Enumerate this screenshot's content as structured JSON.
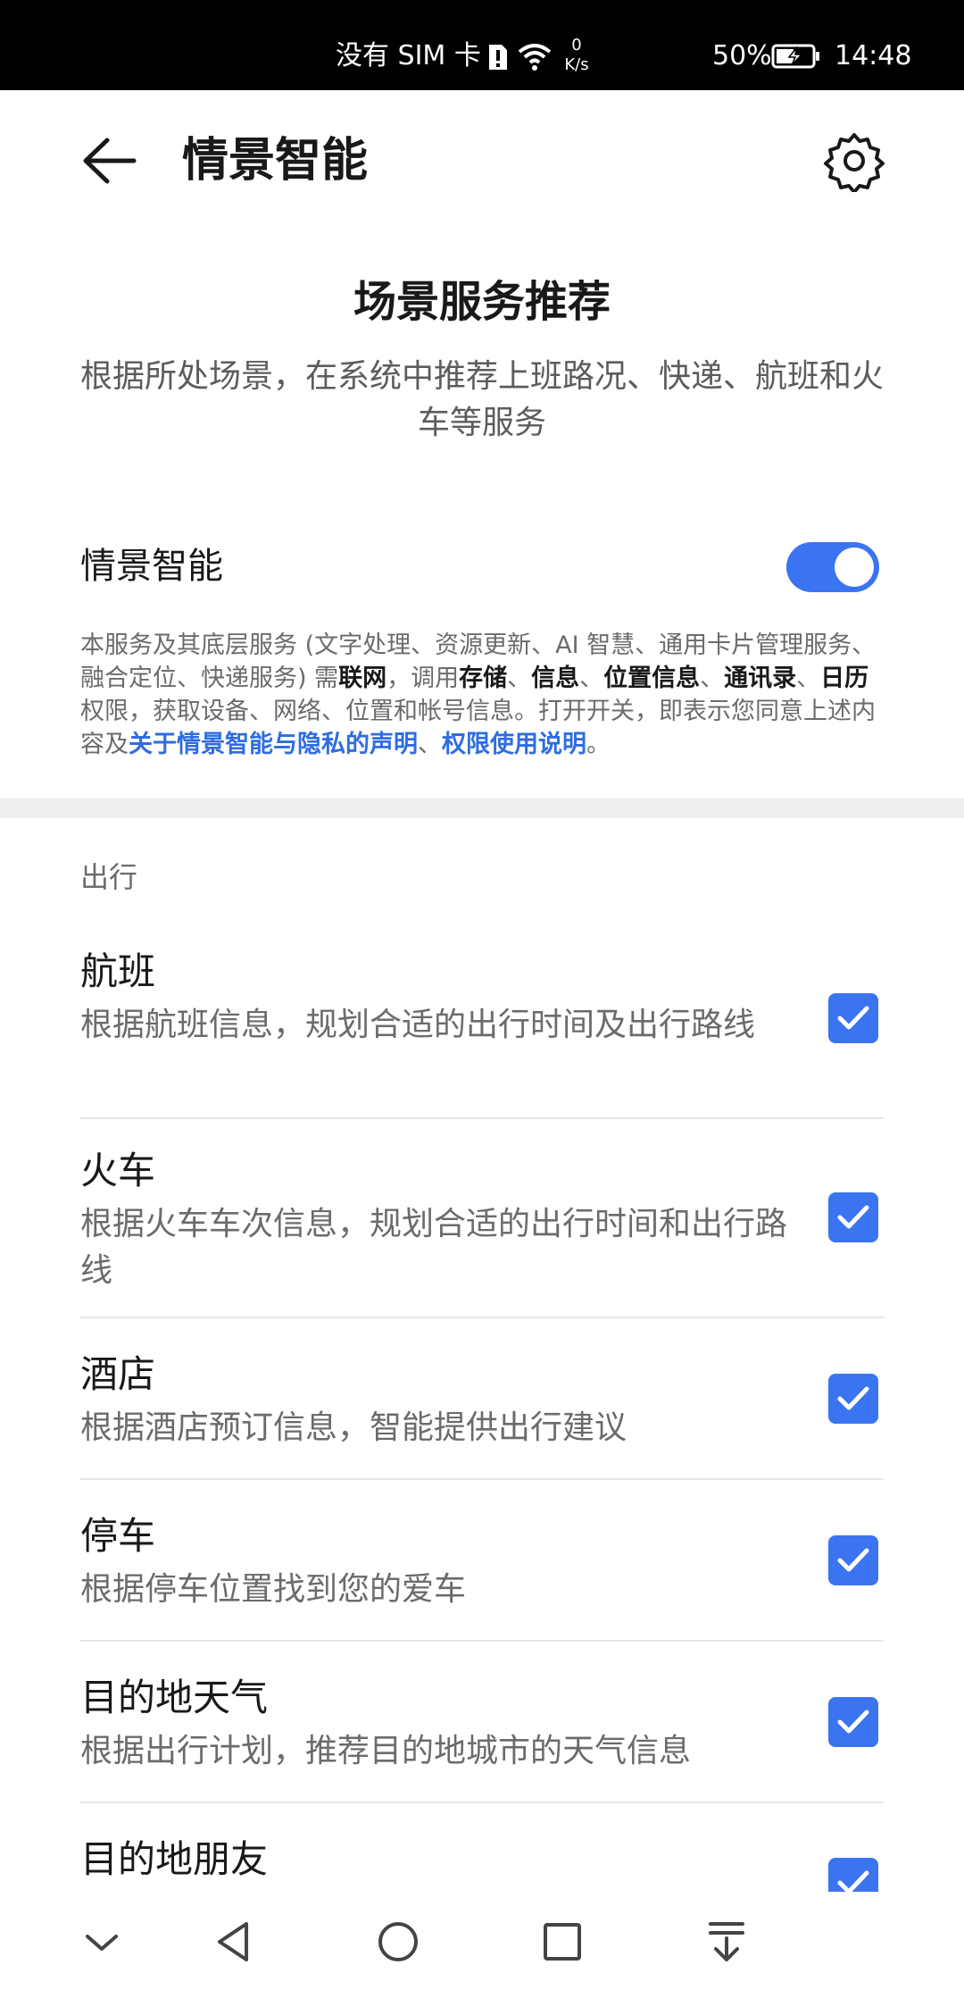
{
  "status_bar": {
    "carrier": "没有 SIM 卡",
    "net_speed_value": "0",
    "net_speed_unit": "K/s",
    "battery_percent": "50%",
    "time": "14:48"
  },
  "header": {
    "title": "情景智能"
  },
  "hero": {
    "title": "场景服务推荐",
    "subtitle": "根据所处场景，在系统中推荐上班路况、快递、航班和火车等服务"
  },
  "toggle": {
    "label": "情景智能",
    "on": true
  },
  "notice": {
    "p1": "本服务及其底层服务 (文字处理、资源更新、AI 智慧、通用卡片管理服务、融合定位、快递服务) 需",
    "b1": "联网",
    "p2": "，调用",
    "b2": "存储",
    "p3": "、",
    "b3": "信息",
    "p4": "、",
    "b4": "位置信息",
    "p5": "、",
    "b5": "通讯录",
    "p6": "、",
    "b6": "日历",
    "p7": "权限，获取设备、网络、位置和帐号信息。打开开关，即表示您同意上述内容及",
    "link1": "关于情景智能与隐私的声明",
    "p8": "、",
    "link2": "权限使用说明",
    "p9": "。"
  },
  "section": {
    "label": "出行"
  },
  "items": [
    {
      "title": "航班",
      "desc": "根据航班信息，规划合适的出行时间及出行路线",
      "checked": true
    },
    {
      "title": "火车",
      "desc": "根据火车车次信息，规划合适的出行时间和出行路线",
      "checked": true
    },
    {
      "title": "酒店",
      "desc": "根据酒店预订信息，智能提供出行建议",
      "checked": true
    },
    {
      "title": "停车",
      "desc": "根据停车位置找到您的爱车",
      "checked": true
    },
    {
      "title": "目的地天气",
      "desc": "根据出行计划，推荐目的地城市的天气信息",
      "checked": true
    },
    {
      "title": "目的地朋友",
      "desc": "",
      "checked": true
    }
  ],
  "colors": {
    "accent": "#3b74f0",
    "link": "#2f6de0"
  }
}
